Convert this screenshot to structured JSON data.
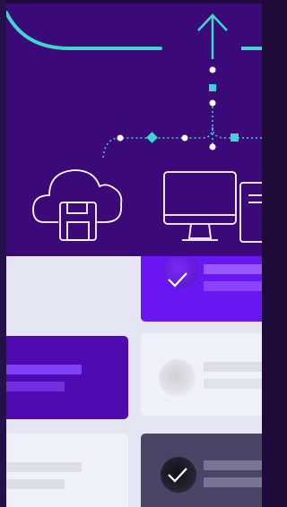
{
  "icons": {
    "upload": "arrow-up-icon",
    "cloud": "cloud-save-icon",
    "desktop": "desktop-computer-icon",
    "check": "checkmark-icon"
  },
  "colors": {
    "hero_bg": "#3c0a78",
    "accent_cyan": "#3fd6d0",
    "card_purple": "#6a16f0",
    "card_deep_purple": "#4f0ab2",
    "card_light": "#eef0fa",
    "card_dark": "#4b4466",
    "line_white": "#ffffff"
  },
  "cards": [
    {
      "id": "a",
      "state": "selected",
      "checked": true
    },
    {
      "id": "b",
      "state": "highlighted",
      "checked": false
    },
    {
      "id": "c",
      "state": "default",
      "checked": false
    },
    {
      "id": "d",
      "state": "default",
      "checked": false
    },
    {
      "id": "e",
      "state": "selected-dark",
      "checked": true
    }
  ]
}
